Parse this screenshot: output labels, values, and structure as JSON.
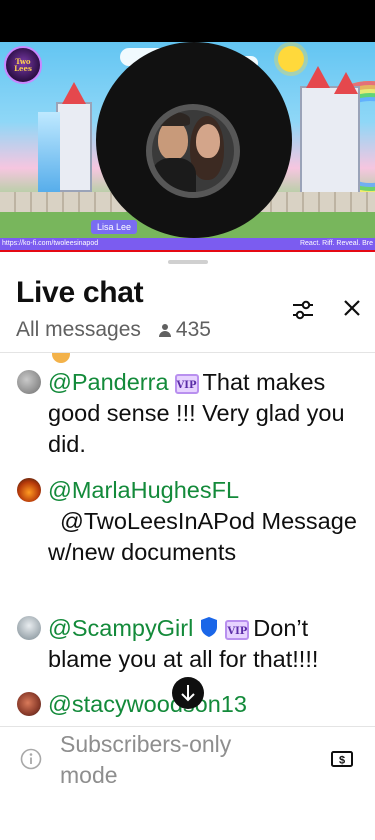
{
  "video": {
    "channel_logo_text": "Two Lees",
    "streamer_name": "Lisa Lee",
    "banner_left": "https://ko-fi.com/twoleesinapod",
    "banner_right": "React. Riff. Reveal. Bre"
  },
  "chat": {
    "title": "Live chat",
    "filter_label": "All messages",
    "viewer_count": "435",
    "messages": [
      {
        "author": "@Panderra",
        "badges": [
          "VIP"
        ],
        "text": "That makes good sense !!! Very glad you did."
      },
      {
        "author": "@MarlaHughesFL",
        "badges": [],
        "text": "@TwoLeesInAPod Message w/new documents"
      },
      {
        "author": "@ScampyGirl",
        "badges": [
          "moderator-shield",
          "VIP"
        ],
        "text": "Don’t blame you at all for that!!!!"
      },
      {
        "author": "@stacywoodson13",
        "badges": [],
        "text": ""
      }
    ],
    "input_placeholder": "Subscribers-only mode"
  },
  "colors": {
    "author_green": "#138a3a",
    "banner_purple": "#7b5cf0",
    "vip_badge": "#e7d3ff",
    "shield_blue": "#1a66e8"
  },
  "icons": {
    "filter": "sliders-icon",
    "close": "close-icon",
    "viewers": "person-icon",
    "scroll": "arrow-down-icon",
    "info": "info-icon",
    "super_chat": "dollar-icon"
  }
}
